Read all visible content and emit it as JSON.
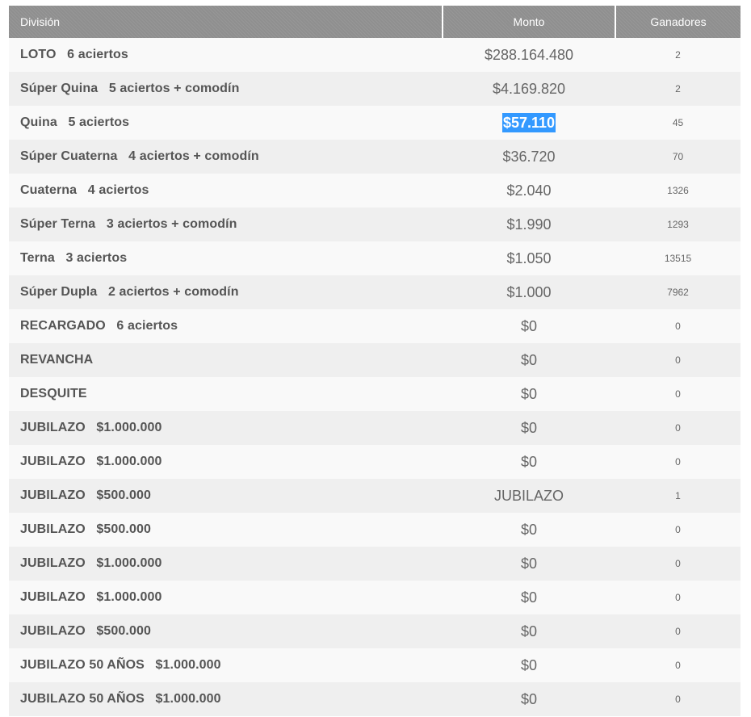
{
  "table": {
    "headers": {
      "division": "División",
      "monto": "Monto",
      "ganadores": "Ganadores"
    },
    "rows": [
      {
        "division": "LOTO   6 aciertos",
        "monto": "$288.164.480",
        "ganadores": "2"
      },
      {
        "division": "Súper Quina   5 aciertos + comodín",
        "monto": "$4.169.820",
        "ganadores": "2"
      },
      {
        "division": "Quina   5 aciertos",
        "monto": "$57.110",
        "ganadores": "45",
        "monto_selected": true
      },
      {
        "division": "Súper Cuaterna   4 aciertos + comodín",
        "monto": "$36.720",
        "ganadores": "70"
      },
      {
        "division": "Cuaterna   4 aciertos",
        "monto": "$2.040",
        "ganadores": "1326"
      },
      {
        "division": "Súper Terna   3 aciertos + comodín",
        "monto": "$1.990",
        "ganadores": "1293"
      },
      {
        "division": "Terna   3 aciertos",
        "monto": "$1.050",
        "ganadores": "13515"
      },
      {
        "division": "Súper Dupla   2 aciertos + comodín",
        "monto": "$1.000",
        "ganadores": "7962"
      },
      {
        "division": "RECARGADO   6 aciertos",
        "monto": "$0",
        "ganadores": "0"
      },
      {
        "division": "REVANCHA",
        "monto": "$0",
        "ganadores": "0"
      },
      {
        "division": "DESQUITE",
        "monto": "$0",
        "ganadores": "0"
      },
      {
        "division": "JUBILAZO   $1.000.000",
        "monto": "$0",
        "ganadores": "0"
      },
      {
        "division": "JUBILAZO   $1.000.000",
        "monto": "$0",
        "ganadores": "0"
      },
      {
        "division": "JUBILAZO   $500.000",
        "monto": "JUBILAZO",
        "ganadores": "1"
      },
      {
        "division": "JUBILAZO   $500.000",
        "monto": "$0",
        "ganadores": "0"
      },
      {
        "division": "JUBILAZO   $1.000.000",
        "monto": "$0",
        "ganadores": "0"
      },
      {
        "division": "JUBILAZO   $1.000.000",
        "monto": "$0",
        "ganadores": "0"
      },
      {
        "division": "JUBILAZO   $500.000",
        "monto": "$0",
        "ganadores": "0"
      },
      {
        "division": "JUBILAZO 50 AÑOS   $1.000.000",
        "monto": "$0",
        "ganadores": "0"
      },
      {
        "division": "JUBILAZO 50 AÑOS   $1.000.000",
        "monto": "$0",
        "ganadores": "0"
      }
    ]
  },
  "colors": {
    "header_bg": "#8f8f8f",
    "row_odd": "#f9f9f9",
    "row_even": "#efefef",
    "selection": "#3399ff"
  }
}
